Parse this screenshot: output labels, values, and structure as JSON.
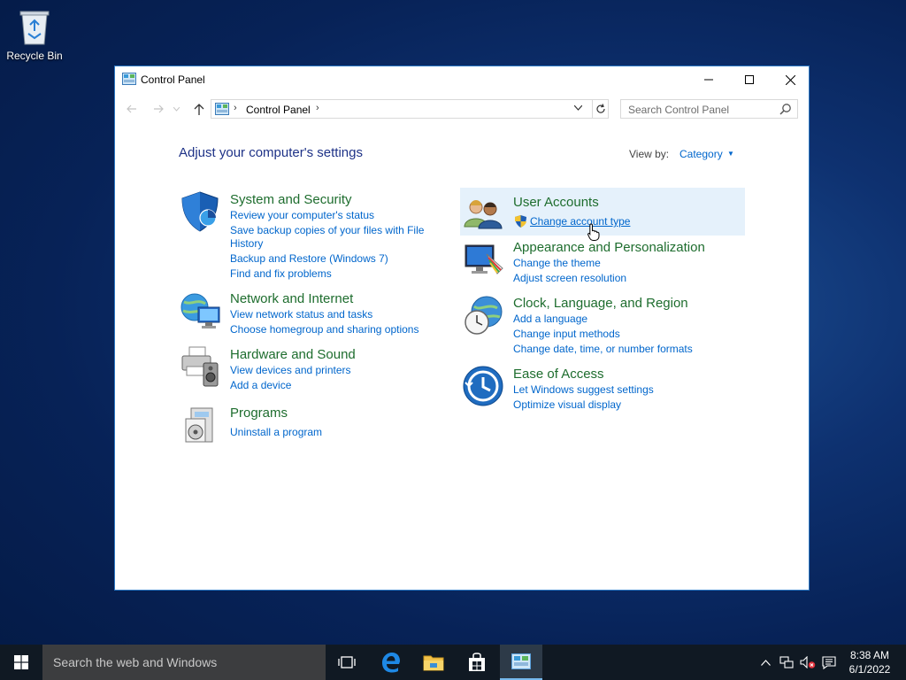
{
  "desktop": {
    "recycle_bin_label": "Recycle Bin"
  },
  "window": {
    "title": "Control Panel",
    "controls": {
      "minimize": "–",
      "maximize": "☐",
      "close": "✕"
    }
  },
  "navigation": {
    "breadcrumb": "Control Panel",
    "search_placeholder": "Search Control Panel"
  },
  "content": {
    "heading": "Adjust your computer's settings",
    "view_by_label": "View by:",
    "view_by_value": "Category",
    "categories_left": [
      {
        "title": "System and Security",
        "icon": "shield-icon",
        "links": [
          "Review your computer's status",
          "Save backup copies of your files with File",
          "History",
          "Backup and Restore (Windows 7)",
          "Find and fix problems"
        ]
      },
      {
        "title": "Network and Internet",
        "icon": "network-icon",
        "links": [
          "View network status and tasks",
          "Choose homegroup and sharing options"
        ]
      },
      {
        "title": "Hardware and Sound",
        "icon": "printer-speaker-icon",
        "links": [
          "View devices and printers",
          "Add a device"
        ]
      },
      {
        "title": "Programs",
        "icon": "programs-icon",
        "links": [
          "Uninstall a program"
        ]
      }
    ],
    "categories_right": [
      {
        "title": "User Accounts",
        "icon": "users-icon",
        "links": [
          "Change account type"
        ]
      },
      {
        "title": "Appearance and Personalization",
        "icon": "monitor-palette-icon",
        "links": [
          "Change the theme",
          "Adjust screen resolution"
        ]
      },
      {
        "title": "Clock, Language, and Region",
        "icon": "clock-globe-icon",
        "links": [
          "Add a language",
          "Change input methods",
          "Change date, time, or number formats"
        ]
      },
      {
        "title": "Ease of Access",
        "icon": "ease-of-access-icon",
        "links": [
          "Let Windows suggest settings",
          "Optimize visual display"
        ]
      }
    ]
  },
  "taskbar": {
    "search_placeholder": "Search the web and Windows",
    "time": "8:38 AM",
    "date": "6/1/2022"
  },
  "colors": {
    "link": "#0066cc",
    "category_title": "#1e6d2e",
    "heading": "#1e3287",
    "taskbar": "#101923"
  }
}
